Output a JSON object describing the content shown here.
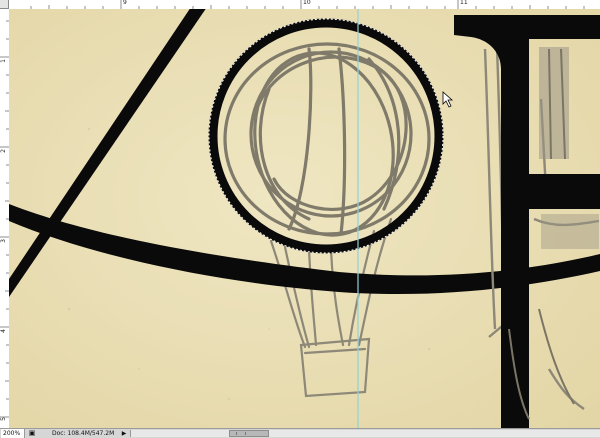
{
  "rulers": {
    "top_ticks": [
      "9",
      "10",
      "11"
    ],
    "left_ticks": [
      "1",
      "2",
      "3",
      "4",
      "5"
    ]
  },
  "status": {
    "zoom": "200%",
    "doc": "Doc: 108.4M/547.2M"
  },
  "colors": {
    "paper": "#ebe0b6",
    "ink": "#0a0a0a",
    "sketch": "#8d8878",
    "guide": "#8fd3d7"
  }
}
